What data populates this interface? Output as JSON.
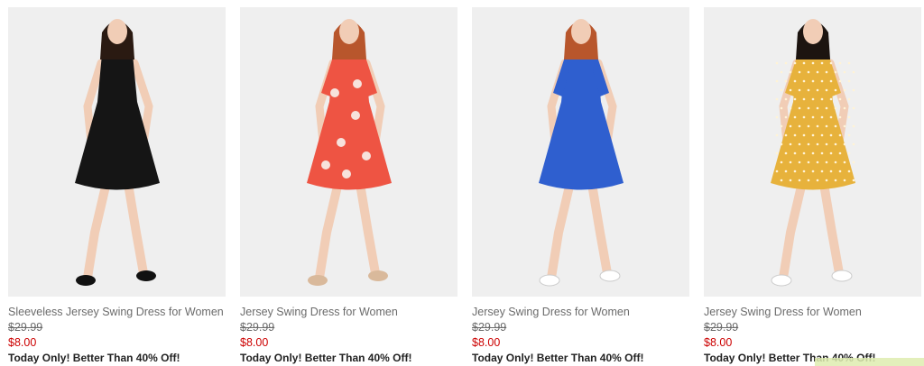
{
  "products": [
    {
      "title": "Sleeveless Jersey Swing Dress for Women",
      "was_price": "$29.99",
      "sale_price": "$8.00",
      "promo": "Today Only! Better Than 40% Off!",
      "dress_color": "#151515",
      "pattern": "solid",
      "sleeves": "none",
      "shoes": "black-flats"
    },
    {
      "title": "Jersey Swing Dress for Women",
      "was_price": "$29.99",
      "sale_price": "$8.00",
      "promo": "Today Only! Better Than 40% Off!",
      "dress_color": "#ee5443",
      "pattern": "floral",
      "sleeves": "elbow",
      "shoes": "sandals"
    },
    {
      "title": "Jersey Swing Dress for Women",
      "was_price": "$29.99",
      "sale_price": "$8.00",
      "promo": "Today Only! Better Than 40% Off!",
      "dress_color": "#2f5fcf",
      "pattern": "solid",
      "sleeves": "elbow",
      "shoes": "white-sneakers"
    },
    {
      "title": "Jersey Swing Dress for Women",
      "was_price": "$29.99",
      "sale_price": "$8.00",
      "promo": "Today Only! Better Than 40% Off!",
      "dress_color": "#e7b23c",
      "pattern": "polka-dot",
      "sleeves": "elbow",
      "shoes": "white-sneakers"
    }
  ],
  "colors": {
    "title": "#6b6b6b",
    "sale_price": "#cc0000",
    "promo": "#222222",
    "photo_bg": "#efefef"
  }
}
